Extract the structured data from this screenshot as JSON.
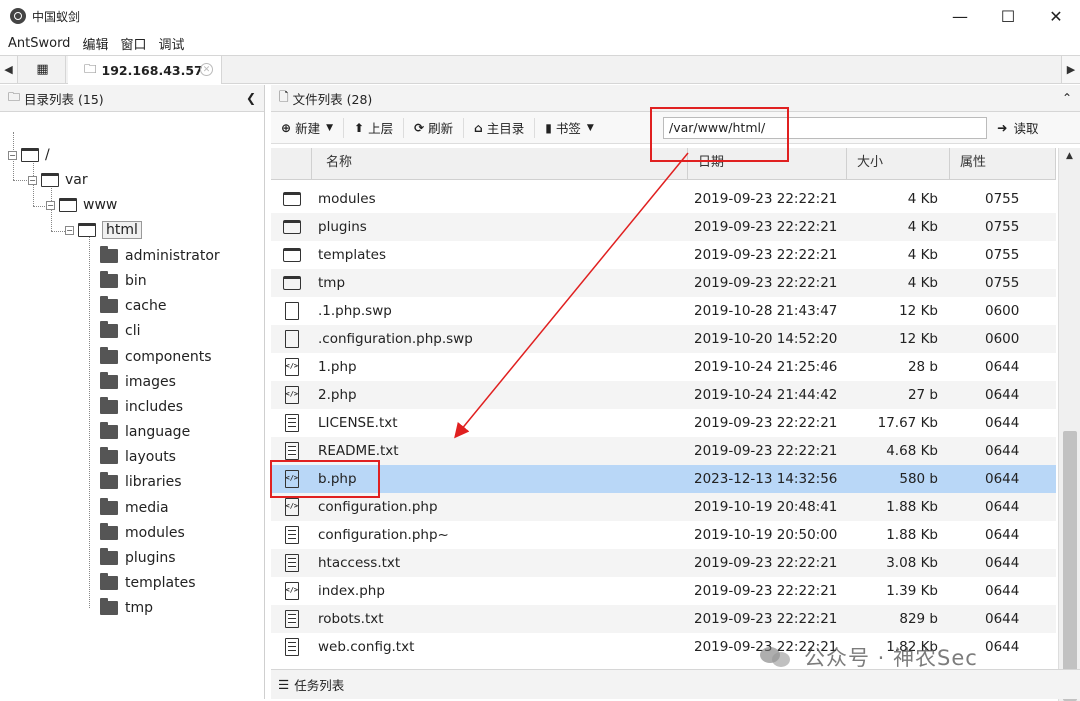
{
  "window": {
    "title": "中国蚁剑",
    "minimize": "—",
    "maximize": "☐",
    "close": "✕"
  },
  "menu": [
    "AntSword",
    "编辑",
    "窗口",
    "调试"
  ],
  "tabs": {
    "left_arrow": "◀",
    "right_arrow": "▶",
    "grid_icon": "▦",
    "host": "192.168.43.57",
    "close": "✕"
  },
  "dir_panel": {
    "title": "目录列表 (15)",
    "collapse": "❮"
  },
  "tree": {
    "root": "/",
    "var": "var",
    "www": "www",
    "html": "html",
    "children": [
      "administrator",
      "bin",
      "cache",
      "cli",
      "components",
      "images",
      "includes",
      "language",
      "layouts",
      "libraries",
      "media",
      "modules",
      "plugins",
      "templates",
      "tmp"
    ]
  },
  "file_panel": {
    "title": "文件列表 (28)",
    "collapse": "⌃"
  },
  "toolbar": {
    "new": "新建",
    "up": "上层",
    "refresh": "刷新",
    "home": "主目录",
    "bookmark": "书签",
    "path": "/var/www/html/",
    "read": "读取"
  },
  "columns": {
    "name": "名称",
    "date": "日期",
    "size": "大小",
    "attr": "属性"
  },
  "files": [
    {
      "type": "folder",
      "name": "modules",
      "date": "2019-09-23 22:22:21",
      "size": "4 Kb",
      "attr": "0755"
    },
    {
      "type": "folder",
      "name": "plugins",
      "date": "2019-09-23 22:22:21",
      "size": "4 Kb",
      "attr": "0755"
    },
    {
      "type": "folder",
      "name": "templates",
      "date": "2019-09-23 22:22:21",
      "size": "4 Kb",
      "attr": "0755"
    },
    {
      "type": "folder",
      "name": "tmp",
      "date": "2019-09-23 22:22:21",
      "size": "4 Kb",
      "attr": "0755"
    },
    {
      "type": "file",
      "name": ".1.php.swp",
      "date": "2019-10-28 21:43:47",
      "size": "12 Kb",
      "attr": "0600"
    },
    {
      "type": "file",
      "name": ".configuration.php.swp",
      "date": "2019-10-20 14:52:20",
      "size": "12 Kb",
      "attr": "0600"
    },
    {
      "type": "code",
      "name": "1.php",
      "date": "2019-10-24 21:25:46",
      "size": "28 b",
      "attr": "0644"
    },
    {
      "type": "code",
      "name": "2.php",
      "date": "2019-10-24 21:44:42",
      "size": "27 b",
      "attr": "0644"
    },
    {
      "type": "text",
      "name": "LICENSE.txt",
      "date": "2019-09-23 22:22:21",
      "size": "17.67 Kb",
      "attr": "0644"
    },
    {
      "type": "text",
      "name": "README.txt",
      "date": "2019-09-23 22:22:21",
      "size": "4.68 Kb",
      "attr": "0644"
    },
    {
      "type": "code",
      "name": "b.php",
      "date": "2023-12-13 14:32:56",
      "size": "580 b",
      "attr": "0644"
    },
    {
      "type": "code",
      "name": "configuration.php",
      "date": "2019-10-19 20:48:41",
      "size": "1.88 Kb",
      "attr": "0644"
    },
    {
      "type": "text",
      "name": "configuration.php~",
      "date": "2019-10-19 20:50:00",
      "size": "1.88 Kb",
      "attr": "0644"
    },
    {
      "type": "text",
      "name": "htaccess.txt",
      "date": "2019-09-23 22:22:21",
      "size": "3.08 Kb",
      "attr": "0644"
    },
    {
      "type": "code",
      "name": "index.php",
      "date": "2019-09-23 22:22:21",
      "size": "1.39 Kb",
      "attr": "0644"
    },
    {
      "type": "text",
      "name": "robots.txt",
      "date": "2019-09-23 22:22:21",
      "size": "829 b",
      "attr": "0644"
    },
    {
      "type": "text",
      "name": "web.config.txt",
      "date": "2019-09-23 22:22:21",
      "size": "1.82 Kb",
      "attr": "0644"
    }
  ],
  "selected_file": "b.php",
  "task_panel": {
    "title": "任务列表"
  },
  "watermark": "公众号 · 神农Sec",
  "colors": {
    "selected_row": "#b9d7f7",
    "highlight_box": "#e02020"
  }
}
